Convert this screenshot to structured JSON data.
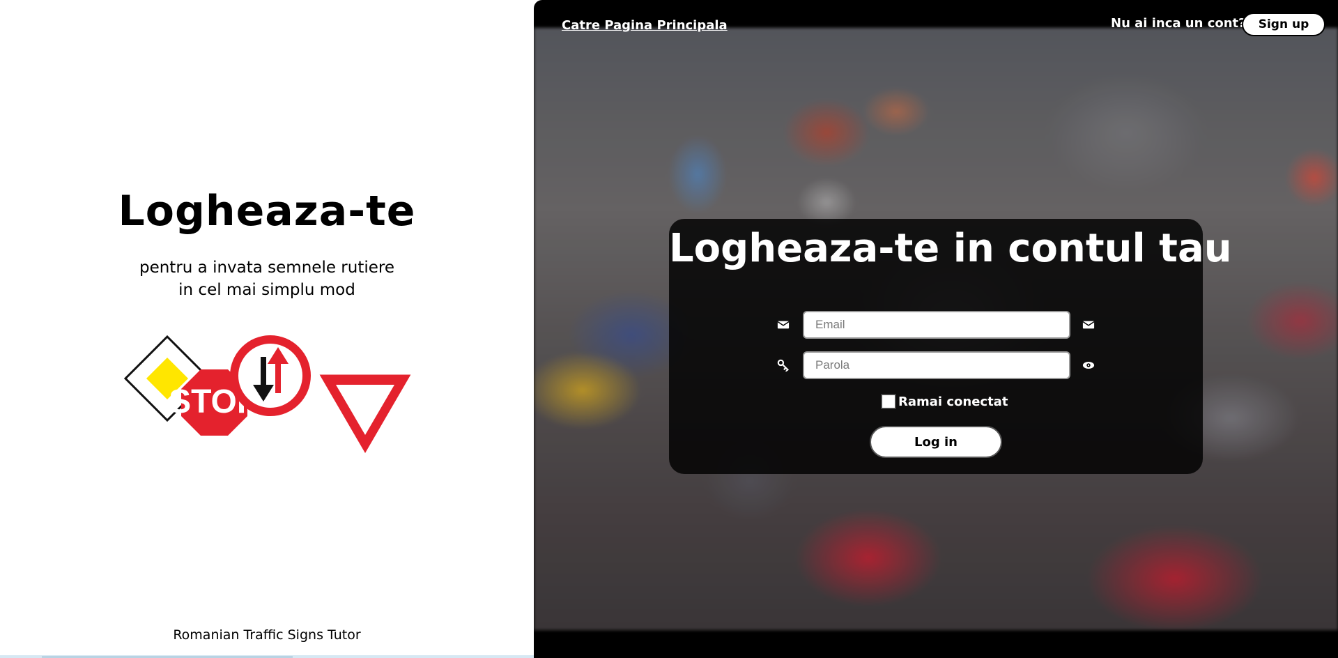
{
  "left": {
    "title": "Logheaza-te",
    "subtitle_line1": "pentru a invata semnele rutiere",
    "subtitle_line2": "in cel mai simplu mod",
    "signs_illustration": {
      "stop_sign_text": "STOP",
      "icons": [
        "priority-road-sign-icon",
        "stop-sign-icon",
        "priority-oncoming-sign-icon",
        "yield-sign-icon"
      ]
    },
    "footer": "Romanian Traffic Signs Tutor"
  },
  "header": {
    "home_link": "Catre Pagina Principala",
    "signup_prompt": "Nu ai inca un cont?",
    "signup_button": "Sign up"
  },
  "login": {
    "title": "Logheaza-te in contul tau",
    "email_placeholder": "Email",
    "email_value": "",
    "password_placeholder": "Parola",
    "password_value": "",
    "remember_label": "Ramai conectat",
    "remember_checked": false,
    "submit_label": "Log in",
    "icons": {
      "email_left": "envelope-icon",
      "email_right": "envelope-icon",
      "password_left": "key-icon",
      "password_right": "eye-icon"
    }
  },
  "colors": {
    "sign_red": "#e4222d",
    "sign_yellow": "#ffe600",
    "panel_bg": "#000000",
    "button_bg": "#ffffff"
  }
}
